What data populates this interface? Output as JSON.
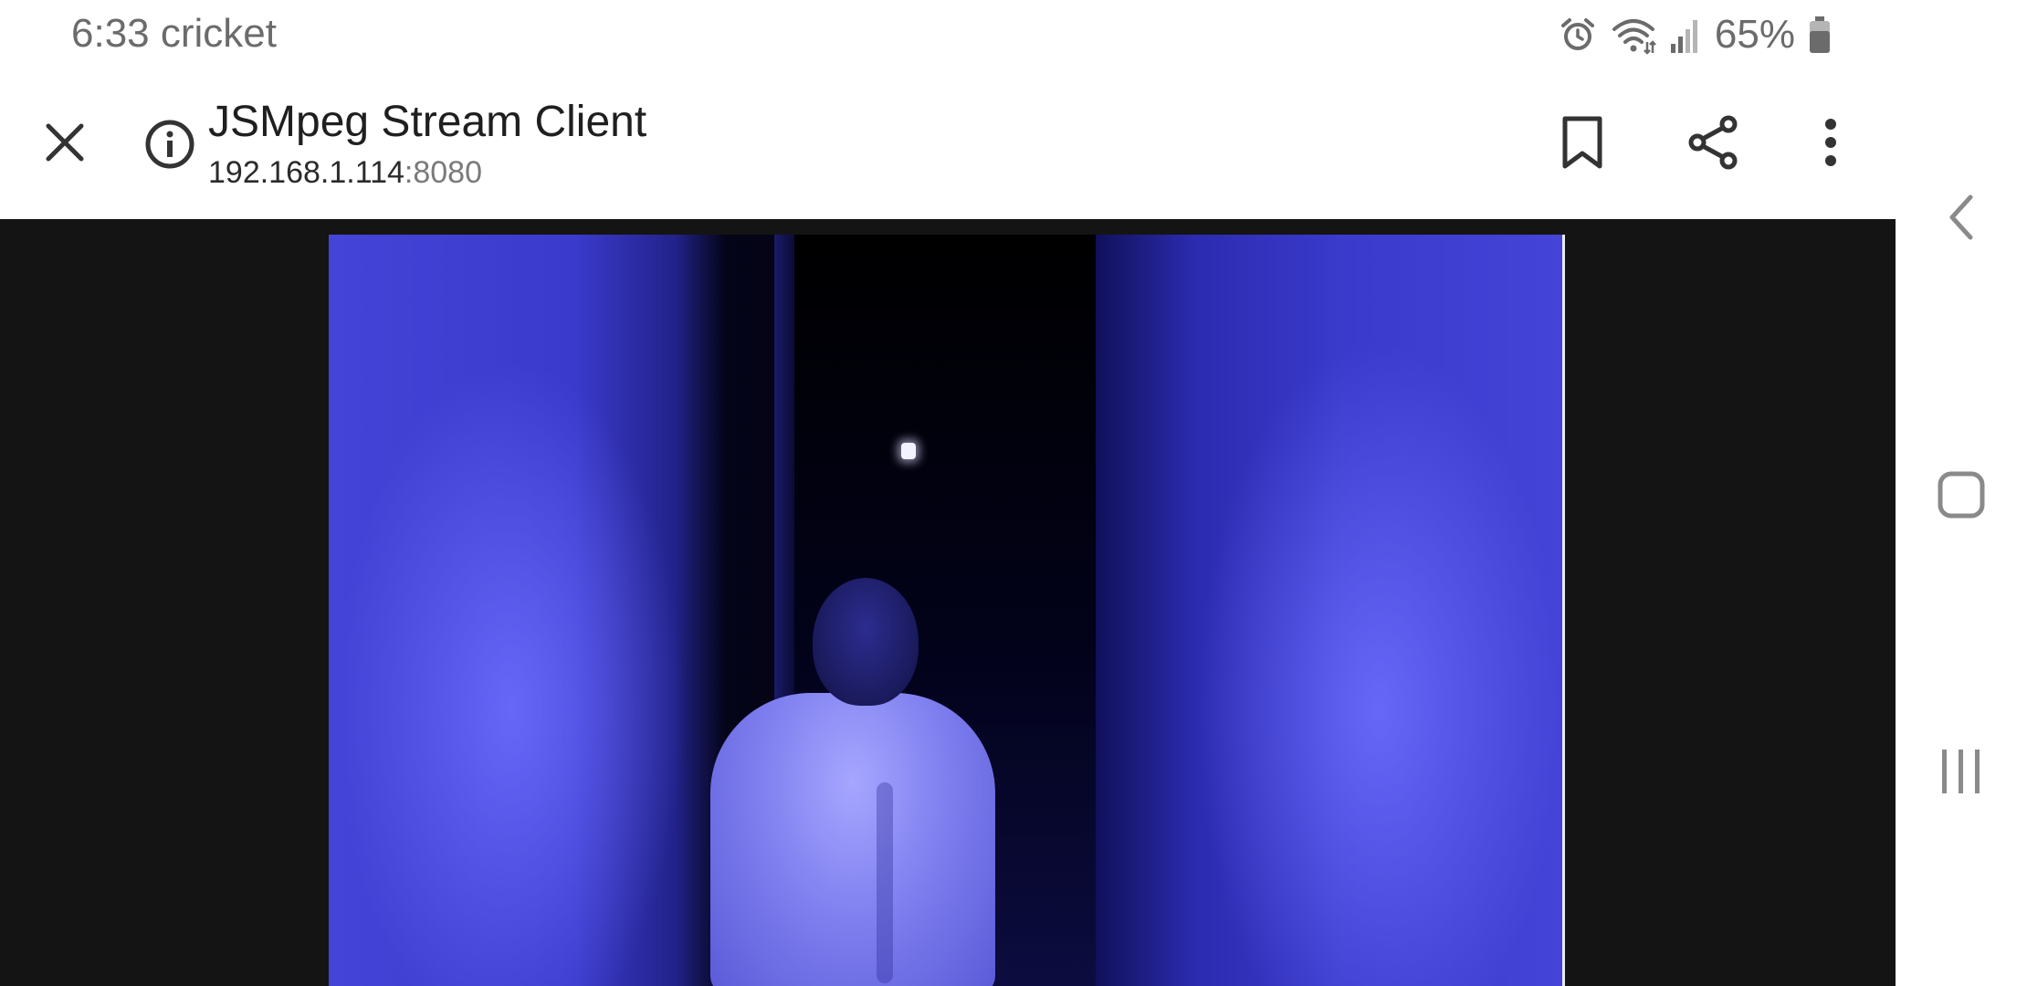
{
  "status_bar": {
    "time_carrier": "6:33 cricket",
    "battery_percent": "65%",
    "icons": [
      "alarm-icon",
      "wifi-icon",
      "signal-icon",
      "battery-icon"
    ]
  },
  "toolbar": {
    "page_title": "JSMpeg Stream Client",
    "url_host": "192.168.1.114",
    "url_port": ":8080",
    "icons": [
      "close-icon",
      "info-icon",
      "bookmark-icon",
      "share-icon",
      "more-vert-icon"
    ]
  },
  "navbar": {
    "icons": [
      "back-icon",
      "home-icon",
      "recent-apps-icon"
    ]
  },
  "colors": {
    "toolbar_bg": "#ffffff",
    "content_bg": "#141414",
    "video_tint": "#3a3acc"
  }
}
